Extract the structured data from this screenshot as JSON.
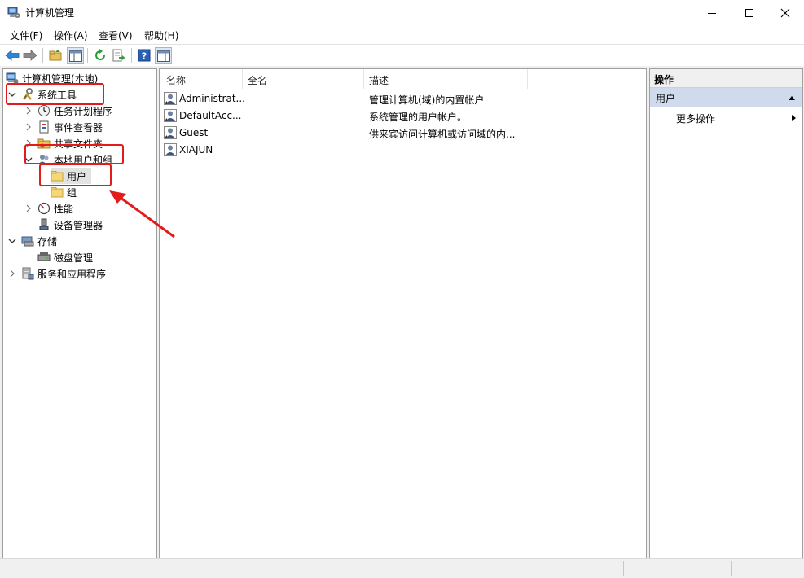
{
  "window": {
    "title": "计算机管理"
  },
  "menu": [
    "文件(F)",
    "操作(A)",
    "查看(V)",
    "帮助(H)"
  ],
  "tree": {
    "root": "计算机管理(本地)",
    "system_tools": "系统工具",
    "task_scheduler": "任务计划程序",
    "event_viewer": "事件查看器",
    "shared_folders": "共享文件夹",
    "local_users_groups": "本地用户和组",
    "users": "用户",
    "groups": "组",
    "performance": "性能",
    "device_manager": "设备管理器",
    "storage": "存储",
    "disk_management": "磁盘管理",
    "services_apps": "服务和应用程序"
  },
  "list": {
    "columns": [
      "名称",
      "全名",
      "描述"
    ],
    "rows": [
      {
        "name": "Administrat...",
        "fullname": "",
        "desc": "管理计算机(域)的内置帐户"
      },
      {
        "name": "DefaultAcc...",
        "fullname": "",
        "desc": "系统管理的用户帐户。"
      },
      {
        "name": "Guest",
        "fullname": "",
        "desc": "供来宾访问计算机或访问域的内..."
      },
      {
        "name": "XIAJUN",
        "fullname": "",
        "desc": ""
      }
    ]
  },
  "actions": {
    "header": "操作",
    "section": "用户",
    "more": "更多操作"
  },
  "colors": {
    "annotation": "#e31b1b",
    "selection": "#cfdbec",
    "accent": "#1f6fc5"
  }
}
